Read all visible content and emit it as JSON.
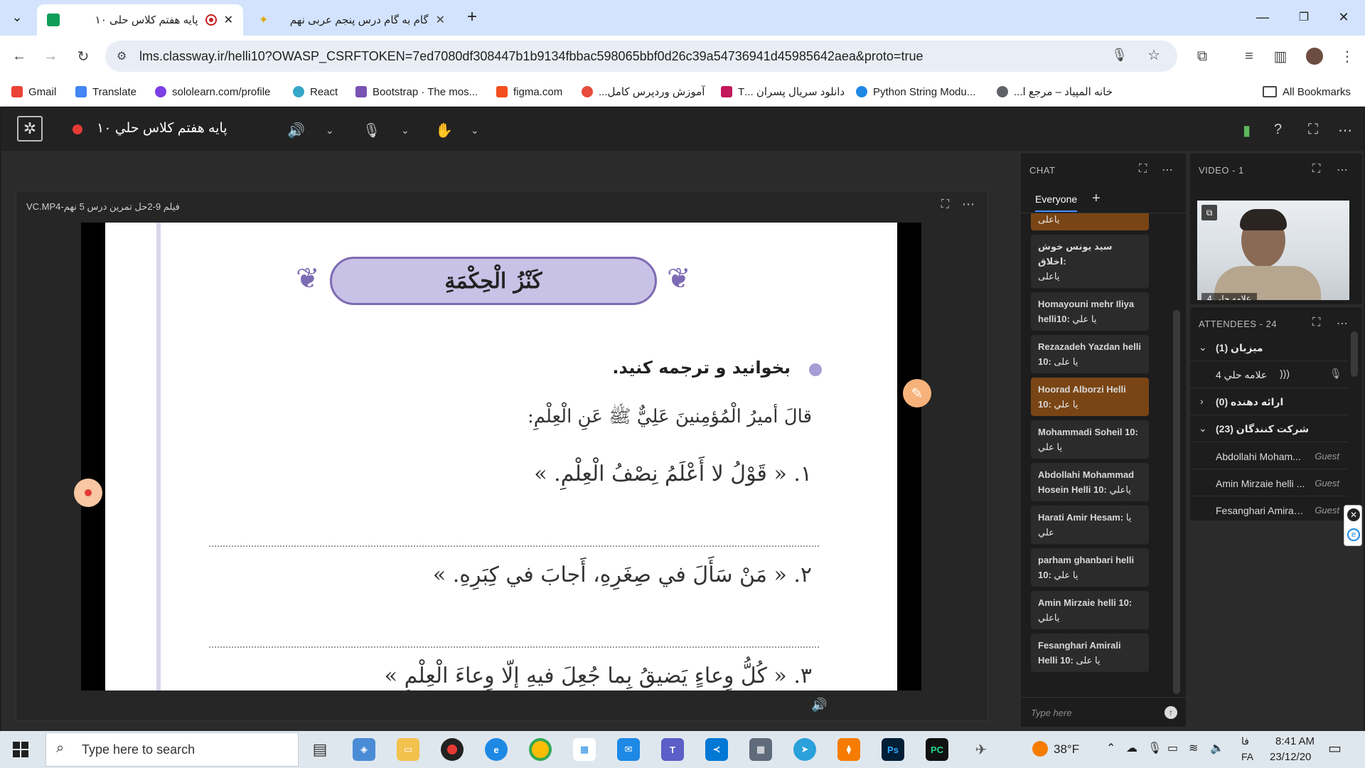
{
  "browser": {
    "tabs": [
      {
        "title": "پایه هفتم کلاس حلی ۱۰",
        "active": true
      },
      {
        "title": "گام به گام درس پنجم عربی نهم",
        "active": false
      }
    ],
    "new_tab": "+",
    "url": "lms.classway.ir/helli10?OWASP_CSRFTOKEN=7ed7080df308447b1b9134fbbac598065bbf0d26c39a54736941d45985642aea&proto=true",
    "bookmarks": [
      {
        "label": "Gmail",
        "color": "#ea4335"
      },
      {
        "label": "Translate",
        "color": "#4285f4"
      },
      {
        "label": "sololearn.com/profile",
        "color": "#7b3fe4"
      },
      {
        "label": "React",
        "color": "#35a7c9"
      },
      {
        "label": "Bootstrap · The mos...",
        "color": "#7952b3"
      },
      {
        "label": "figma.com",
        "color": "#f24e1e"
      },
      {
        "label": "آموزش وردپرس کامل...",
        "color": "#e74c3c"
      },
      {
        "label": "دانلود سریال پسران ...T",
        "color": "#c2185b"
      },
      {
        "label": "Python String Modu...",
        "color": "#1e88e5"
      },
      {
        "label": "خانه المپیاد – مرجع ا...",
        "color": "#5f6368"
      }
    ],
    "all_bookmarks": "All Bookmarks"
  },
  "app": {
    "room_title": "پایه هفتم کلاس حلي ۱۰",
    "recording_color": "#e53935"
  },
  "share": {
    "file_title": "VC.MP4-فیلم 9-2حل تمرین درس 5 نهم",
    "page": {
      "heading": "كَنْزُ الْحِكْمَةِ",
      "instruction": "بخوانید و ترجمه کنید.",
      "intro": "قالَ أميرُ الْمُؤمِنينَ عَلِيٌّ ﷺ عَنِ الْعِلْمِ:",
      "line1": "۱. « قَوْلُ لا أَعْلَمُ نِصْفُ الْعِلْمِ. »",
      "line2": "۲. « مَنْ سَأَلَ في صِغَرِهِ، أَجابَ في كِبَرِهِ. »",
      "line3": "۳. « كُلُّ وِعاءٍ يَضيقُ بِما جُعِلَ فيهِ إلّا وِعاءَ الْعِلْمِ »"
    }
  },
  "chat": {
    "label": "CHAT",
    "tab": "Everyone",
    "placeholder": "Type here",
    "messages": [
      {
        "who": "",
        "text": "یاعلی",
        "highlight": true
      },
      {
        "who": "سید یونس خوش اخلاق:",
        "text": "یاعلی",
        "highlight": false
      },
      {
        "who": "Homayouni mehr Iliya helli10:",
        "text": "یا علي",
        "highlight": false
      },
      {
        "who": "Rezazadeh Yazdan helli 10:",
        "text": "یا علی",
        "highlight": false
      },
      {
        "who": "Hoorad Alborzi Helli 10:",
        "text": "یا علي",
        "highlight": true
      },
      {
        "who": "Mohammadi Soheil 10:",
        "text": "یا علي",
        "highlight": false
      },
      {
        "who": "Abdollahi Mohammad Hosein Helli 10:",
        "text": "یاعلي",
        "highlight": false
      },
      {
        "who": "Harati Amir Hesam:",
        "text": "یا علي",
        "highlight": false
      },
      {
        "who": "parham ghanbari helli 10:",
        "text": "یا علي",
        "highlight": false
      },
      {
        "who": "Amin Mirzaie helli 10:",
        "text": "یاعلي",
        "highlight": false
      },
      {
        "who": "Fesanghari Amirali Helli 10:",
        "text": "یا علی",
        "highlight": false
      }
    ]
  },
  "video": {
    "label": "VIDEO",
    "count": "- 1",
    "cam_name": "علامه حلي 4"
  },
  "attendees": {
    "label": "ATTENDEES",
    "count": "- 24",
    "hosts": {
      "label": "میزبان (1)"
    },
    "host_name": "علامه حلي 4",
    "presenters": {
      "label": "ارائه دهنده (0)"
    },
    "participants": {
      "label": "شرکت کنندگان (23)"
    },
    "guests": [
      {
        "name": "Abdollahi Moham...",
        "role": "Guest"
      },
      {
        "name": "Amin Mirzaie helli ...",
        "role": "Guest"
      },
      {
        "name": "Fesanghari Amirali...",
        "role": "Guest"
      }
    ]
  },
  "taskbar": {
    "search_placeholder": "Type here to search",
    "weather": "38°F",
    "lang_top": "فا",
    "lang_bottom": "FA",
    "time": "8:41 AM",
    "date": "23/12/20"
  }
}
